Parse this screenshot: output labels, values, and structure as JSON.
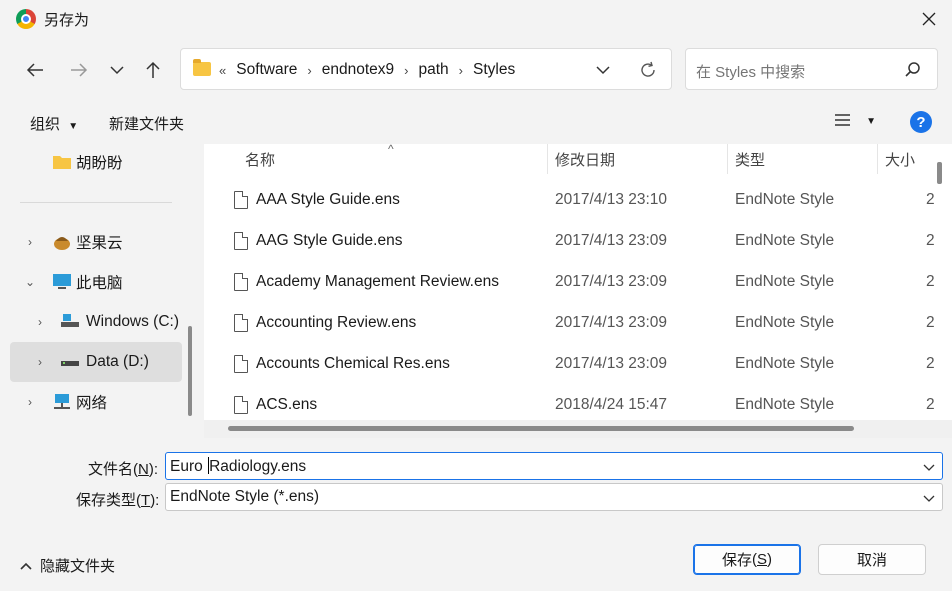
{
  "window": {
    "title": "另存为",
    "close_icon": "close-icon"
  },
  "nav": {
    "breadcrumbs": [
      "Software",
      "endnotex9",
      "path",
      "Styles"
    ],
    "crumb_prefix": "«",
    "search_placeholder": "在 Styles 中搜索"
  },
  "toolbar": {
    "organize": "组织",
    "new_folder": "新建文件夹",
    "help": "?"
  },
  "sidebar": {
    "items": [
      {
        "label": "胡盼盼",
        "icon": "folder-icon"
      },
      {
        "label": "坚果云",
        "icon": "nutstore-icon"
      },
      {
        "label": "此电脑",
        "icon": "computer-icon"
      },
      {
        "label": "Windows (C:)",
        "icon": "drive-icon"
      },
      {
        "label": "Data (D:)",
        "icon": "drive-icon"
      },
      {
        "label": "网络",
        "icon": "network-icon"
      }
    ]
  },
  "columns": {
    "name": "名称",
    "modified": "修改日期",
    "type": "类型",
    "size": "大小"
  },
  "files": [
    {
      "name": "AAA Style Guide.ens",
      "modified": "2017/4/13 23:10",
      "type": "EndNote Style",
      "size": "2"
    },
    {
      "name": "AAG Style Guide.ens",
      "modified": "2017/4/13 23:09",
      "type": "EndNote Style",
      "size": "2"
    },
    {
      "name": "Academy Management Review.ens",
      "modified": "2017/4/13 23:09",
      "type": "EndNote Style",
      "size": "2"
    },
    {
      "name": "Accounting Review.ens",
      "modified": "2017/4/13 23:09",
      "type": "EndNote Style",
      "size": "2"
    },
    {
      "name": "Accounts Chemical Res.ens",
      "modified": "2017/4/13 23:09",
      "type": "EndNote Style",
      "size": "2"
    },
    {
      "name": "ACS.ens",
      "modified": "2018/4/24 15:47",
      "type": "EndNote Style",
      "size": "2"
    }
  ],
  "form": {
    "filename_label": "文件名",
    "filename_hotkey": "N",
    "filename_value_a": "Euro",
    "filename_value_b": "Radiology.ens",
    "filetype_label": "保存类型",
    "filetype_hotkey": "T",
    "filetype_value": "EndNote Style (*.ens)"
  },
  "footer": {
    "hide_folders": "隐藏文件夹",
    "save_label": "保存",
    "save_hotkey": "S",
    "cancel": "取消"
  },
  "colors": {
    "accent": "#1a73e8"
  }
}
